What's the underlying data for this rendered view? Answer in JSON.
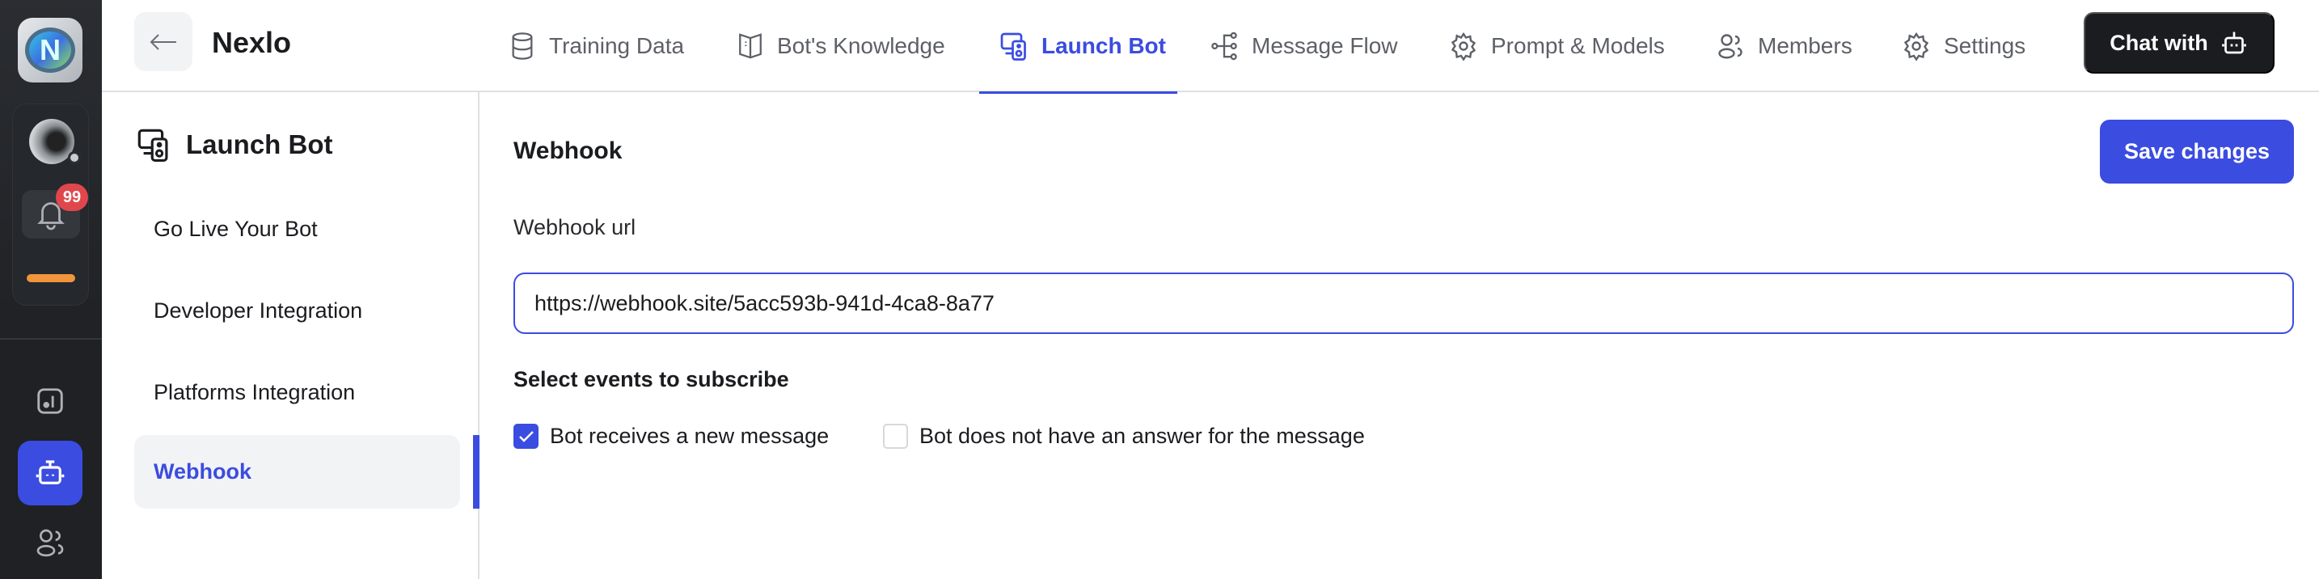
{
  "rail": {
    "badge_count": "99",
    "accent": "#3b4ce0",
    "progress_color": "#f0953c"
  },
  "header": {
    "brand": "Nexlo",
    "tabs": [
      {
        "label": "Training Data",
        "icon": "database-icon"
      },
      {
        "label": "Bot's Knowledge",
        "icon": "book-icon"
      },
      {
        "label": "Launch Bot",
        "icon": "launch-bot-icon",
        "active": true
      },
      {
        "label": "Message Flow",
        "icon": "flow-icon"
      },
      {
        "label": "Prompt & Models",
        "icon": "gear-icon"
      },
      {
        "label": "Members",
        "icon": "users-icon"
      },
      {
        "label": "Settings",
        "icon": "gear-icon"
      }
    ],
    "chat_label": "Chat with"
  },
  "subnav": {
    "title": "Launch Bot",
    "items": [
      {
        "label": "Go Live Your Bot"
      },
      {
        "label": "Developer Integration"
      },
      {
        "label": "Platforms Integration"
      },
      {
        "label": "Webhook",
        "active": true
      }
    ]
  },
  "main": {
    "title": "Webhook",
    "save_label": "Save changes",
    "url_label": "Webhook url",
    "url_value": "https://webhook.site/5acc593b-941d-4ca8-8a77",
    "events_label": "Select events to subscribe",
    "events": [
      {
        "label": "Bot receives a new message",
        "checked": true
      },
      {
        "label": "Bot does not have an answer for the message",
        "checked": false
      }
    ]
  }
}
